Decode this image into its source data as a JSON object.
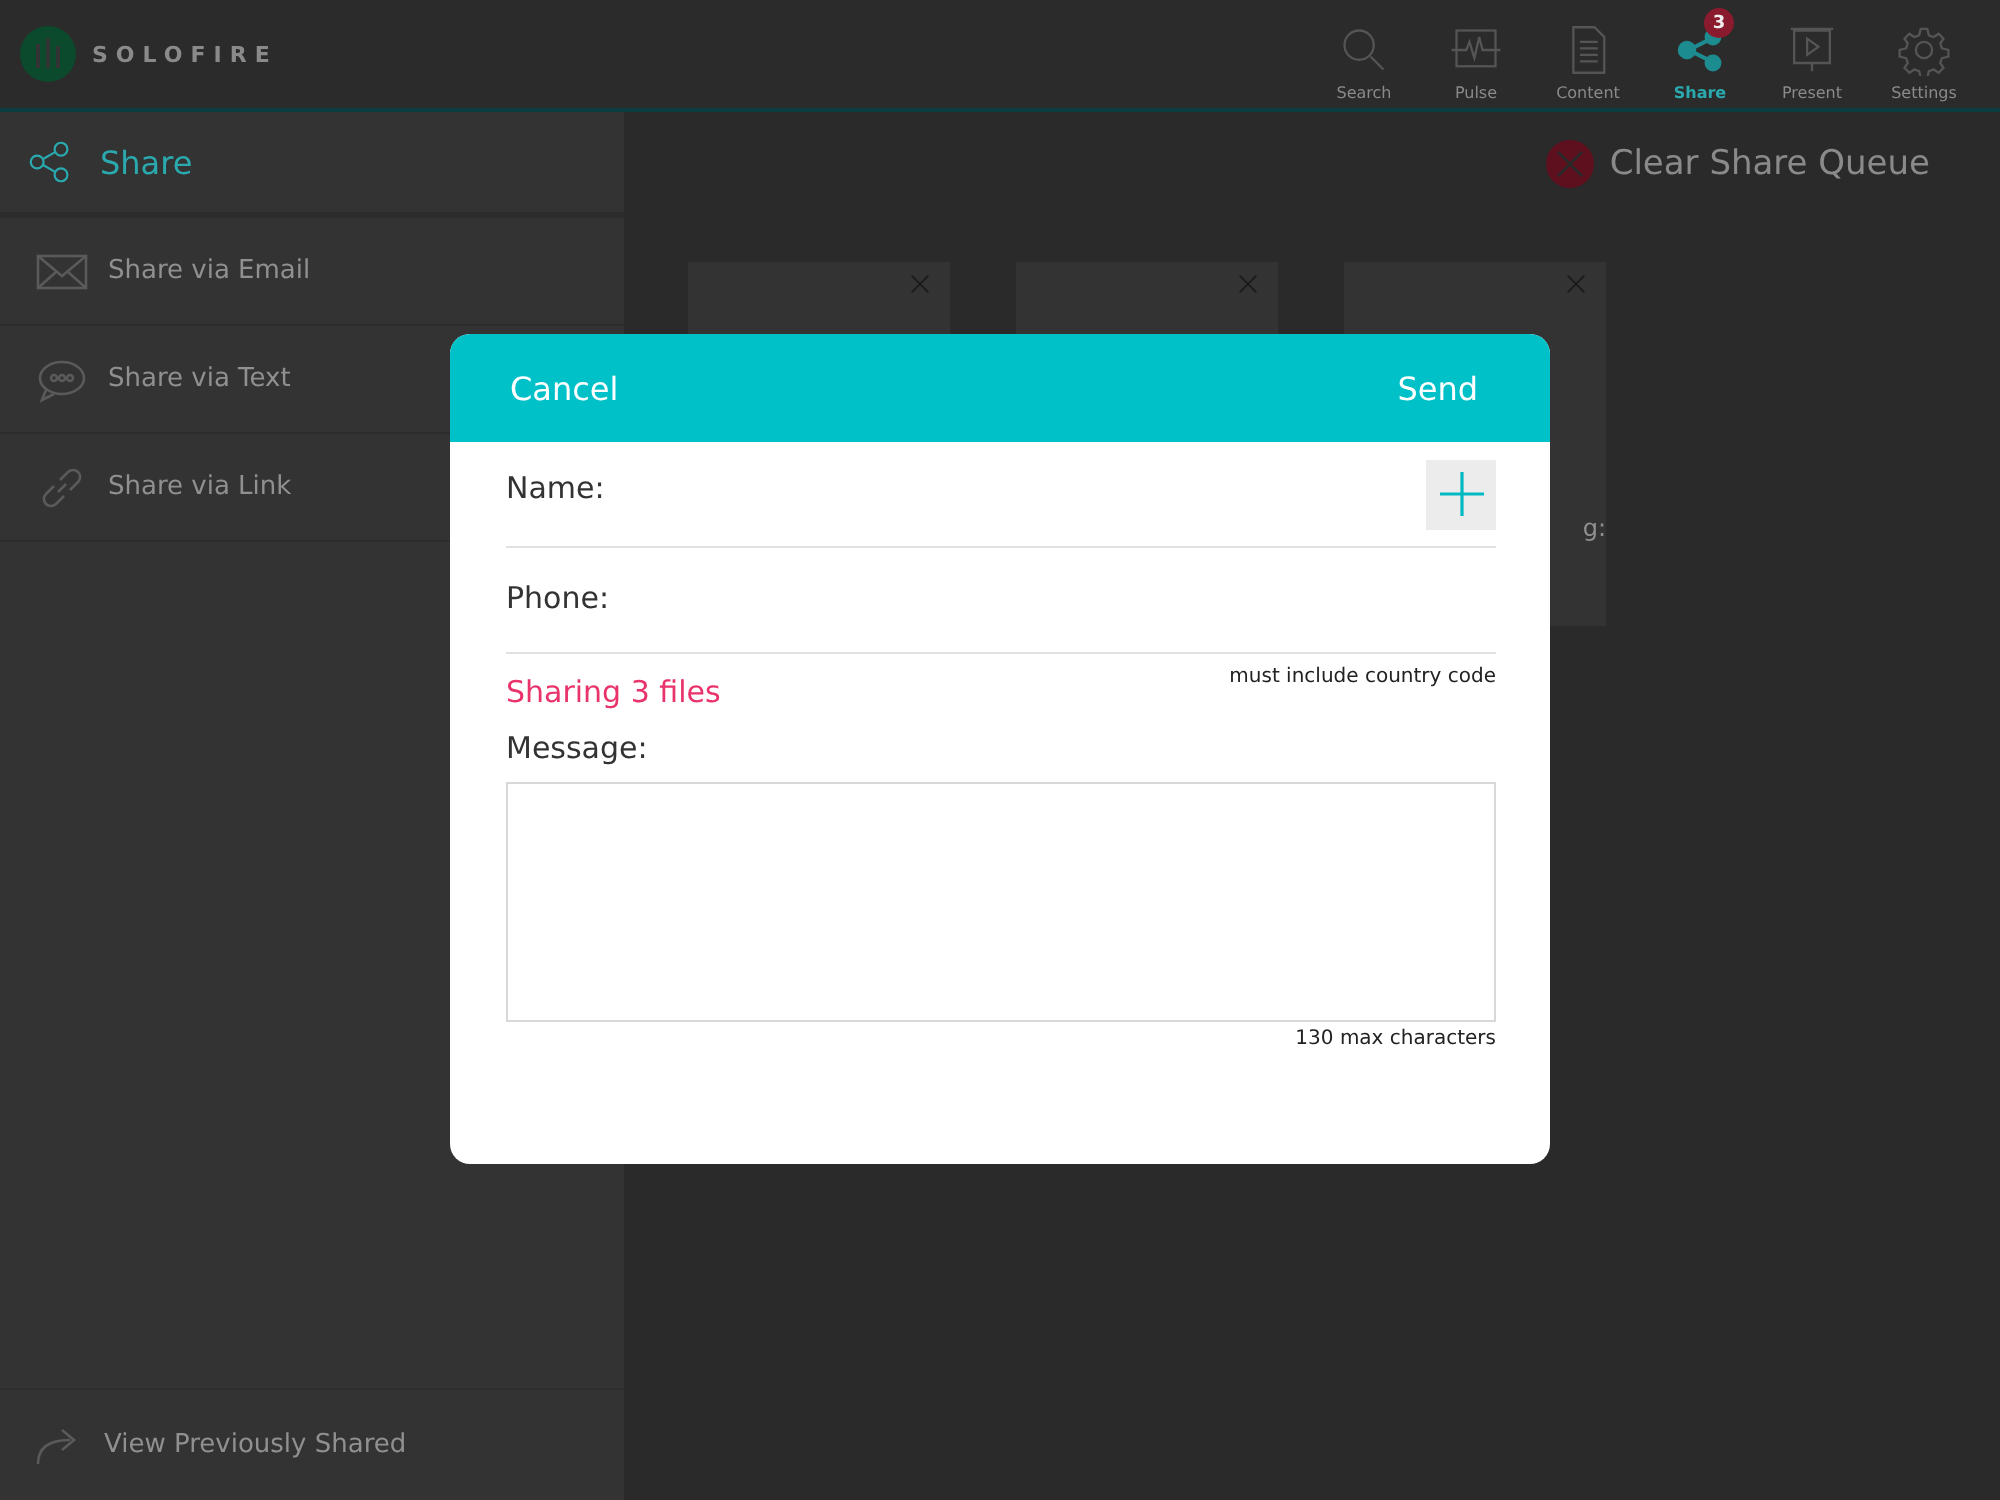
{
  "app": {
    "logo_text": "SOLOFIRE"
  },
  "nav": [
    {
      "label": "Search",
      "kind": "search",
      "selected": false
    },
    {
      "label": "Pulse",
      "kind": "pulse",
      "selected": false
    },
    {
      "label": "Content",
      "kind": "content",
      "selected": false
    },
    {
      "label": "Share",
      "kind": "share",
      "selected": true,
      "badge": "3"
    },
    {
      "label": "Present",
      "kind": "present",
      "selected": false
    },
    {
      "label": "Settings",
      "kind": "settings",
      "selected": false
    }
  ],
  "sidebar": {
    "title": "Share",
    "items": [
      {
        "label": "Share via Email",
        "kind": "email"
      },
      {
        "label": "Share via Text",
        "kind": "text"
      },
      {
        "label": "Share via Link",
        "kind": "link"
      }
    ],
    "footer": {
      "label": "View Previously Shared"
    }
  },
  "main": {
    "clear_button": "Clear Share Queue",
    "cards": [
      {
        "kind": "card"
      },
      {
        "kind": "card"
      },
      {
        "kind": "card",
        "fragment": "g:"
      }
    ]
  },
  "dialog": {
    "cancel": "Cancel",
    "send": "Send",
    "name_label": "Name:",
    "phone_label": "Phone:",
    "phone_hint": "must include country code",
    "sharing": "Sharing 3 files",
    "message_label": "Message:",
    "message_hint": "130 max characters"
  }
}
